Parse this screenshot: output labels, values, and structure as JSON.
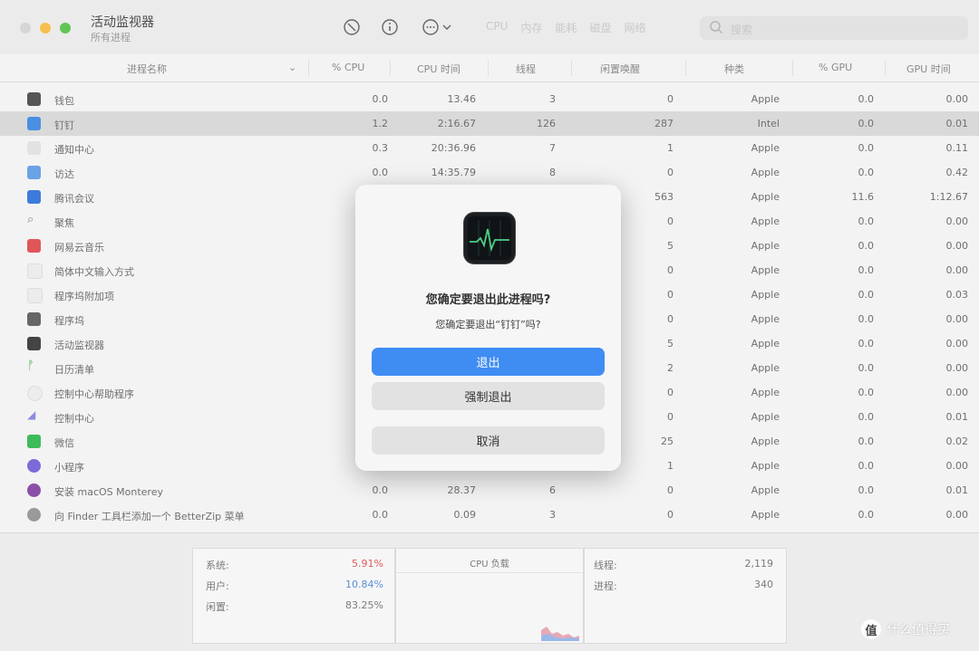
{
  "window": {
    "title": "活动监视器",
    "subtitle": "所有进程"
  },
  "toolbar": {
    "stop_icon": "stop-process-icon",
    "info_icon": "info-icon",
    "more_icon": "more-actions-icon",
    "tabs": [
      "CPU",
      "内存",
      "能耗",
      "磁盘",
      "网络"
    ],
    "search_placeholder": "搜索"
  },
  "table": {
    "headers": {
      "name": "进程名称",
      "cpu": "% CPU",
      "cpu_time": "CPU 时间",
      "threads": "线程",
      "idle_wake": "闲置唤醒",
      "kind": "种类",
      "gpu": "% GPU",
      "gpu_time": "GPU 时间"
    },
    "rows": [
      {
        "name": "钱包",
        "cpu": "0.0",
        "cpu_time": "13.46",
        "threads": "3",
        "idle": "0",
        "kind": "Apple",
        "gpu": "0.0",
        "gpu_time": "0.00"
      },
      {
        "name": "钉钉",
        "cpu": "1.2",
        "cpu_time": "2:16.67",
        "threads": "126",
        "idle": "287",
        "kind": "Intel",
        "gpu": "0.0",
        "gpu_time": "0.01"
      },
      {
        "name": "通知中心",
        "cpu": "0.3",
        "cpu_time": "20:36.96",
        "threads": "7",
        "idle": "1",
        "kind": "Apple",
        "gpu": "0.0",
        "gpu_time": "0.11"
      },
      {
        "name": "访达",
        "cpu": "0.0",
        "cpu_time": "14:35.79",
        "threads": "8",
        "idle": "0",
        "kind": "Apple",
        "gpu": "0.0",
        "gpu_time": "0.42"
      },
      {
        "name": "腾讯会议",
        "cpu": "",
        "cpu_time": "",
        "threads": "",
        "idle": "563",
        "kind": "Apple",
        "gpu": "11.6",
        "gpu_time": "1:12.67"
      },
      {
        "name": "聚焦",
        "cpu": "",
        "cpu_time": "",
        "threads": "",
        "idle": "0",
        "kind": "Apple",
        "gpu": "0.0",
        "gpu_time": "0.00"
      },
      {
        "name": "网易云音乐",
        "cpu": "",
        "cpu_time": "",
        "threads": "",
        "idle": "5",
        "kind": "Apple",
        "gpu": "0.0",
        "gpu_time": "0.00"
      },
      {
        "name": "简体中文输入方式",
        "cpu": "",
        "cpu_time": "",
        "threads": "",
        "idle": "0",
        "kind": "Apple",
        "gpu": "0.0",
        "gpu_time": "0.00"
      },
      {
        "name": "程序坞附加项",
        "cpu": "",
        "cpu_time": "",
        "threads": "",
        "idle": "0",
        "kind": "Apple",
        "gpu": "0.0",
        "gpu_time": "0.03"
      },
      {
        "name": "程序坞",
        "cpu": "",
        "cpu_time": "",
        "threads": "",
        "idle": "0",
        "kind": "Apple",
        "gpu": "0.0",
        "gpu_time": "0.00"
      },
      {
        "name": "活动监视器",
        "cpu": "",
        "cpu_time": "",
        "threads": "",
        "idle": "5",
        "kind": "Apple",
        "gpu": "0.0",
        "gpu_time": "0.00"
      },
      {
        "name": "日历清单",
        "cpu": "",
        "cpu_time": "",
        "threads": "",
        "idle": "2",
        "kind": "Apple",
        "gpu": "0.0",
        "gpu_time": "0.00"
      },
      {
        "name": "控制中心帮助程序",
        "cpu": "",
        "cpu_time": "",
        "threads": "",
        "idle": "0",
        "kind": "Apple",
        "gpu": "0.0",
        "gpu_time": "0.00"
      },
      {
        "name": "控制中心",
        "cpu": "",
        "cpu_time": "",
        "threads": "",
        "idle": "0",
        "kind": "Apple",
        "gpu": "0.0",
        "gpu_time": "0.01"
      },
      {
        "name": "微信",
        "cpu": "",
        "cpu_time": "",
        "threads": "",
        "idle": "25",
        "kind": "Apple",
        "gpu": "0.0",
        "gpu_time": "0.02"
      },
      {
        "name": "小程序",
        "cpu": "",
        "cpu_time": "",
        "threads": "",
        "idle": "1",
        "kind": "Apple",
        "gpu": "0.0",
        "gpu_time": "0.00"
      },
      {
        "name": "安装 macOS Monterey",
        "cpu": "0.0",
        "cpu_time": "28.37",
        "threads": "6",
        "idle": "0",
        "kind": "Apple",
        "gpu": "0.0",
        "gpu_time": "0.01"
      },
      {
        "name": "向 Finder 工具栏添加一个 BetterZip 菜单",
        "cpu": "0.0",
        "cpu_time": "0.09",
        "threads": "3",
        "idle": "0",
        "kind": "Apple",
        "gpu": "0.0",
        "gpu_time": "0.00"
      }
    ]
  },
  "footer": {
    "system_label": "系统:",
    "system_value": "5.91%",
    "user_label": "用户:",
    "user_value": "10.84%",
    "idle_label": "闲置:",
    "idle_value": "83.25%",
    "cpu_load_label": "CPU 负载",
    "threads_label": "线程:",
    "threads_value": "2,119",
    "processes_label": "进程:",
    "processes_value": "340"
  },
  "dialog": {
    "title": "您确定要退出此进程吗?",
    "message": "您确定要退出“钉钉”吗?",
    "quit_label": "退出",
    "force_quit_label": "强制退出",
    "cancel_label": "取消"
  },
  "watermark": {
    "text": "什么值得买",
    "icon_text": "值"
  },
  "colors": {
    "accent": "#3f8cf3",
    "system_red": "#e05a5a",
    "user_blue": "#5a8fd8"
  }
}
